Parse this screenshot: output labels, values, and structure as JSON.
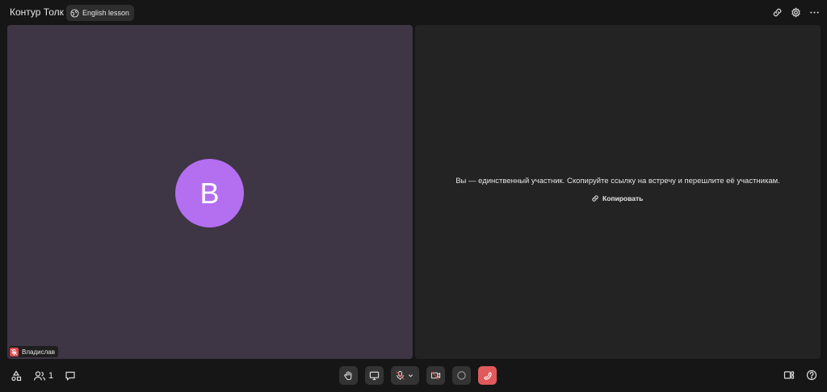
{
  "app": {
    "title": "Контур Толк"
  },
  "meeting": {
    "name": "English lesson"
  },
  "participant": {
    "initial": "В",
    "name": "Владислав"
  },
  "solo": {
    "message": "Вы — единственный участник. Скопируйте ссылку на встречу и перешлите её участникам.",
    "copy_label": "Копировать"
  },
  "bottom": {
    "participants_count": "1"
  },
  "colors": {
    "avatar_bg": "#b46ff0",
    "left_tile_bg": "#3e3545",
    "right_tile_bg": "#232323",
    "end_call": "#e05a5c",
    "mic_off_badge": "#e5484d"
  },
  "icons": {
    "top": [
      "link-icon",
      "gear-icon",
      "more-icon"
    ],
    "controls": [
      "raise-hand-icon",
      "screen-share-icon",
      "mic-off-icon",
      "chevron-down-icon",
      "camera-off-icon",
      "record-icon",
      "end-call-icon"
    ],
    "bottom_left": [
      "shapes-icon",
      "participants-icon",
      "chat-icon"
    ],
    "bottom_right": [
      "layout-icon",
      "help-icon"
    ]
  }
}
